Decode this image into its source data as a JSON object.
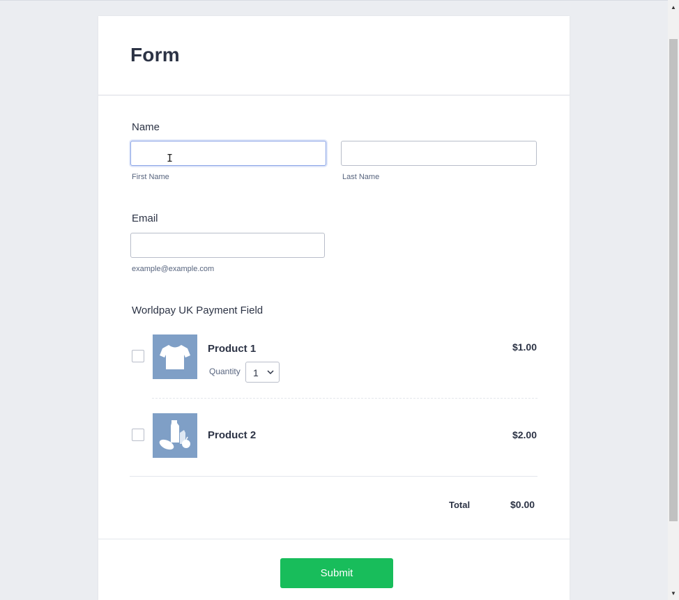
{
  "form": {
    "title": "Form",
    "name": {
      "label": "Name",
      "first_label": "First Name",
      "last_label": "Last Name",
      "first_value": "",
      "last_value": ""
    },
    "email": {
      "label": "Email",
      "sublabel": "example@example.com",
      "value": ""
    },
    "payment": {
      "label": "Worldpay UK Payment Field",
      "products": [
        {
          "name": "Product 1",
          "price": "$1.00",
          "checked": false,
          "quantity_label": "Quantity",
          "quantity": "1",
          "icon": "tshirt-icon"
        },
        {
          "name": "Product 2",
          "price": "$2.00",
          "checked": false,
          "icon": "groceries-icon"
        }
      ],
      "total_label": "Total",
      "total_value": "$0.00"
    },
    "submit_label": "Submit"
  },
  "colors": {
    "page_bg": "#ebedf1",
    "card_bg": "#ffffff",
    "accent_submit": "#18bd5b",
    "product_image_bg": "#7f9fc6",
    "text": "#2c3345"
  }
}
